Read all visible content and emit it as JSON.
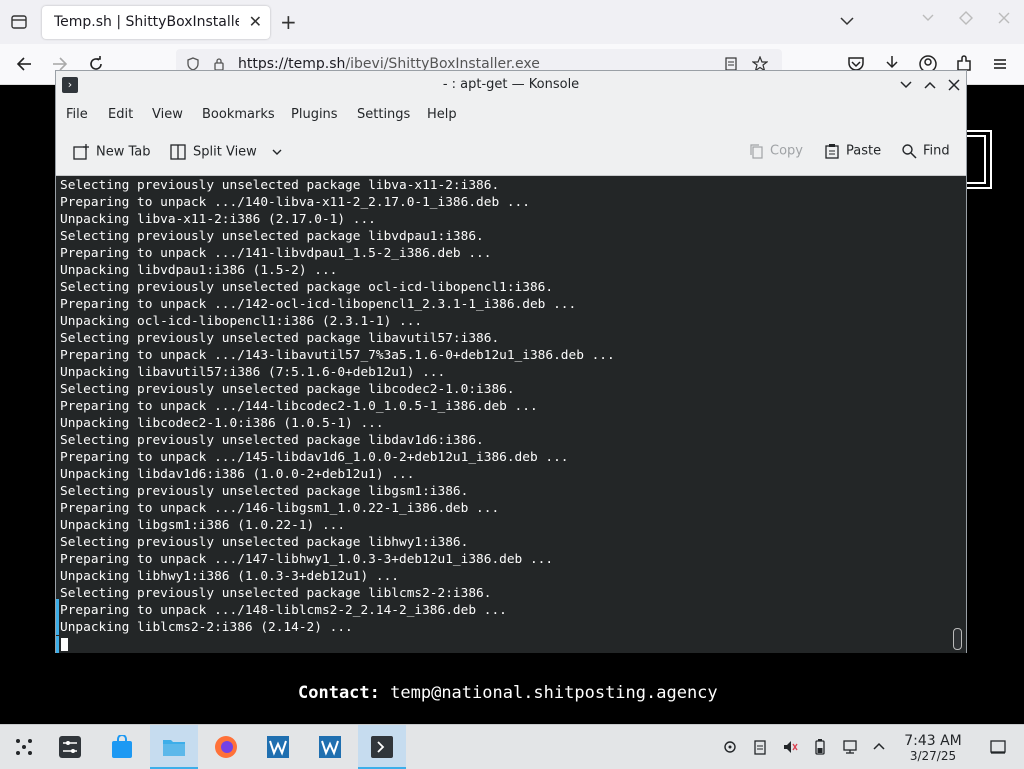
{
  "browser": {
    "tab_title": "Temp.sh | ShittyBoxInstaller.exe",
    "new_tab": "+",
    "close_tab": "✕",
    "url_domain": "https://temp.sh",
    "url_path": "/ibevi/ShittyBoxInstaller.exe"
  },
  "konsole": {
    "title": "- : apt-get — Konsole",
    "menu": [
      "File",
      "Edit",
      "View",
      "Bookmarks",
      "Plugins",
      "Settings",
      "Help"
    ],
    "toolbar": {
      "new_tab": "New Tab",
      "split_view": "Split View",
      "copy": "Copy",
      "paste": "Paste",
      "find": "Find"
    },
    "terminal_lines": [
      "Selecting previously unselected package libva-x11-2:i386.",
      "Preparing to unpack .../140-libva-x11-2_2.17.0-1_i386.deb ...",
      "Unpacking libva-x11-2:i386 (2.17.0-1) ...",
      "Selecting previously unselected package libvdpau1:i386.",
      "Preparing to unpack .../141-libvdpau1_1.5-2_i386.deb ...",
      "Unpacking libvdpau1:i386 (1.5-2) ...",
      "Selecting previously unselected package ocl-icd-libopencl1:i386.",
      "Preparing to unpack .../142-ocl-icd-libopencl1_2.3.1-1_i386.deb ...",
      "Unpacking ocl-icd-libopencl1:i386 (2.3.1-1) ...",
      "Selecting previously unselected package libavutil57:i386.",
      "Preparing to unpack .../143-libavutil57_7%3a5.1.6-0+deb12u1_i386.deb ...",
      "Unpacking libavutil57:i386 (7:5.1.6-0+deb12u1) ...",
      "Selecting previously unselected package libcodec2-1.0:i386.",
      "Preparing to unpack .../144-libcodec2-1.0_1.0.5-1_i386.deb ...",
      "Unpacking libcodec2-1.0:i386 (1.0.5-1) ...",
      "Selecting previously unselected package libdav1d6:i386.",
      "Preparing to unpack .../145-libdav1d6_1.0.0-2+deb12u1_i386.deb ...",
      "Unpacking libdav1d6:i386 (1.0.0-2+deb12u1) ...",
      "Selecting previously unselected package libgsm1:i386.",
      "Preparing to unpack .../146-libgsm1_1.0.22-1_i386.deb ...",
      "Unpacking libgsm1:i386 (1.0.22-1) ...",
      "Selecting previously unselected package libhwy1:i386.",
      "Preparing to unpack .../147-libhwy1_1.0.3-3+deb12u1_i386.deb ...",
      "Unpacking libhwy1:i386 (1.0.3-3+deb12u1) ...",
      "Selecting previously unselected package liblcms2-2:i386.",
      "Preparing to unpack .../148-liblcms2-2_2.14-2_i386.deb ...",
      "Unpacking liblcms2-2:i386 (2.14-2) ..."
    ]
  },
  "page": {
    "contact_label": "Contact:",
    "contact_email": "temp@national.shitposting.agency"
  },
  "taskbar": {
    "time": "7:43 AM",
    "date": "3/27/25"
  },
  "colors": {
    "terminal_bg": "#232627",
    "accent": "#3daee9"
  }
}
